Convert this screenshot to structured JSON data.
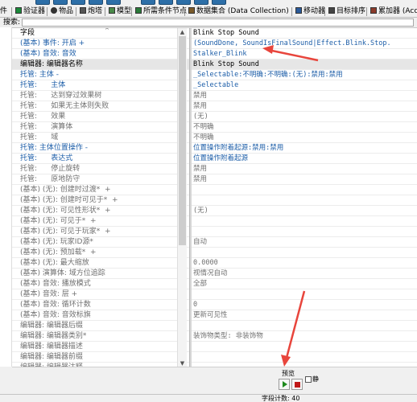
{
  "tabs": [
    {
      "label": "件",
      "icon": "tab-generic-icon"
    },
    {
      "label": "验证器",
      "icon": "validator-icon"
    },
    {
      "label": "物品",
      "icon": "item-icon"
    },
    {
      "label": "炮塔",
      "icon": "turret-icon"
    },
    {
      "label": "模型",
      "icon": "model-icon"
    },
    {
      "label": "所需条件节点",
      "icon": "requirement-node-icon"
    },
    {
      "label": "数据集合 (Data Collection)",
      "icon": "data-collection-icon"
    },
    {
      "label": "移动器",
      "icon": "mover-icon"
    },
    {
      "label": "目标排序",
      "icon": "target-sort-icon"
    },
    {
      "label": "累加器 (Accu",
      "icon": "accumulator-icon"
    }
  ],
  "search": {
    "label": "搜索:",
    "value": ""
  },
  "grid": {
    "header": {
      "field": "字段",
      "value": "Blink Stop Sound"
    },
    "rows": [
      {
        "field": "(基本) 事件: 开启 +",
        "value": "(SoundDone, SoundIsFinalSound|Effect.Blink.Stop.",
        "fc": "blue",
        "vc": "blue"
      },
      {
        "field": "(基本) 音效: 音效",
        "value": "Stalker_Blink",
        "fc": "blue",
        "vc": "blue"
      },
      {
        "field": "编辑器: 编辑器名称",
        "value": "Blink Stop Sound",
        "fc": "black",
        "vc": "black",
        "sel": true
      },
      {
        "field": "托管: 主体 -",
        "value": "_Selectable:不明确:不明确:(无):禁用:禁用",
        "fc": "blue",
        "vc": "blue"
      },
      {
        "field": "托管:      主体",
        "value": "_Selectable",
        "fc": "blue",
        "vc": "blue"
      },
      {
        "field": "托管:      达到穿过效果树",
        "value": "禁用",
        "fc": "grey",
        "vc": "grey"
      },
      {
        "field": "托管:      如果无主体则失败",
        "value": "禁用",
        "fc": "grey",
        "vc": "grey"
      },
      {
        "field": "托管:      效果",
        "value": "(无)",
        "fc": "grey",
        "vc": "grey"
      },
      {
        "field": "托管:      演算体",
        "value": "不明确",
        "fc": "grey",
        "vc": "grey"
      },
      {
        "field": "托管:      域",
        "value": "不明确",
        "fc": "grey",
        "vc": "grey"
      },
      {
        "field": "托管: 主体位置操作 -",
        "value": "位置操作附着起源:禁用:禁用",
        "fc": "blue",
        "vc": "blue"
      },
      {
        "field": "托管:      表达式",
        "value": "位置操作附着起源",
        "fc": "blue",
        "vc": "blue"
      },
      {
        "field": "托管:      停止旋转",
        "value": "禁用",
        "fc": "grey",
        "vc": "grey"
      },
      {
        "field": "托管:      原地防守",
        "value": "禁用",
        "fc": "grey",
        "vc": "grey"
      },
      {
        "field": "(基本) (无): 创建时过渡*  +",
        "value": "",
        "fc": "grey",
        "vc": "grey"
      },
      {
        "field": "(基本) (无): 创建时可见于*  +",
        "value": "",
        "fc": "grey",
        "vc": "grey"
      },
      {
        "field": "(基本) (无): 可见性形状*  +",
        "value": "(无)",
        "fc": "grey",
        "vc": "grey"
      },
      {
        "field": "(基本) (无): 可见于*  +",
        "value": "",
        "fc": "grey",
        "vc": "grey"
      },
      {
        "field": "(基本) (无): 可见于玩家*  +",
        "value": "",
        "fc": "grey",
        "vc": "grey"
      },
      {
        "field": "(基本) (无): 玩家ID源*",
        "value": "自动",
        "fc": "grey",
        "vc": "grey"
      },
      {
        "field": "(基本) (无): 预加载*  +",
        "value": "",
        "fc": "grey",
        "vc": "grey"
      },
      {
        "field": "(基本) (无): 最大缩放",
        "value": "0.0000",
        "fc": "grey",
        "vc": "grey"
      },
      {
        "field": "(基本) 演算体: 域方位追踪",
        "value": "视情况自动",
        "fc": "grey",
        "vc": "grey"
      },
      {
        "field": "(基本) 音效: 播放模式",
        "value": "全部",
        "fc": "grey",
        "vc": "grey"
      },
      {
        "field": "(基本) 音效: 层 +",
        "value": "",
        "fc": "grey",
        "vc": "grey"
      },
      {
        "field": "(基本) 音效: 循环计数",
        "value": "0",
        "fc": "grey",
        "vc": "grey"
      },
      {
        "field": "(基本) 音效: 音效标旗",
        "value": "更新可见性",
        "fc": "grey",
        "vc": "grey"
      },
      {
        "field": "编辑器: 编辑器后缀",
        "value": "",
        "fc": "grey",
        "vc": "grey"
      },
      {
        "field": "编辑器: 编辑器类别*",
        "value": "装饰物类型: 非装饰物",
        "fc": "grey",
        "vc": "grey"
      },
      {
        "field": "编辑器: 编辑器描述",
        "value": "",
        "fc": "grey",
        "vc": "grey"
      },
      {
        "field": "编辑器: 编辑器前缀",
        "value": "",
        "fc": "grey",
        "vc": "grey"
      },
      {
        "field": "编辑器: 编辑器注释",
        "value": "",
        "fc": "grey",
        "vc": "grey"
      }
    ]
  },
  "preview": {
    "label": "预览",
    "checkbox_label": "静"
  },
  "status": {
    "text": "字段计数: 40"
  },
  "colors": {
    "annotation": "#e8453c",
    "link_blue": "#1d5ea8"
  }
}
